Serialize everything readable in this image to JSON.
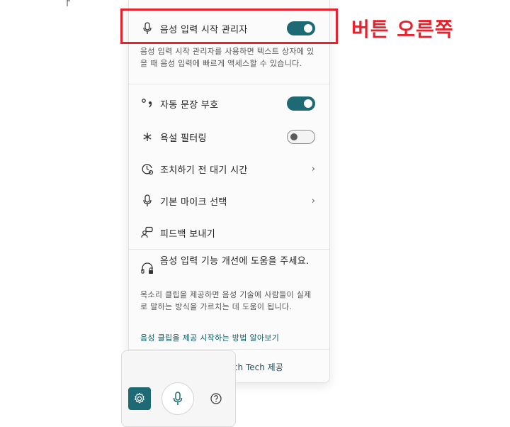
{
  "settings": {
    "launcher": {
      "label": "음성 입력 시작 관리자",
      "enabled": true,
      "description": "음성 입력 시작 관리자를 사용하면 텍스트 상자에 있을 때 음성 입력에 빠르게 액세스할 수 있습니다."
    },
    "auto_punctuation": {
      "label": "자동 문장 부호",
      "enabled": true
    },
    "profanity_filter": {
      "label": "욕설 필터링",
      "enabled": false
    },
    "wait_time": {
      "label": "조치하기 전 대기 시간"
    },
    "default_mic": {
      "label": "기본 마이크 선택"
    },
    "feedback": {
      "label": "피드백 보내기"
    },
    "improve": {
      "title": "음성 입력 기능 개선에 도움을 주세요.",
      "description": "목소리 클립을 제공하면 음성 기술에 사람들이 실제로 말하는 방식을 가르치는 데 도움이 됩니다.",
      "link": "음성 클립을 제공 시작하는 방법 알아보기"
    },
    "provider": "Microsoft Online Speech Tech 제공"
  },
  "annotation": {
    "text": "버튼 오른쪽",
    "color": "#e8222d"
  },
  "colors": {
    "accent": "#1d6a75",
    "link": "#0f5b66"
  },
  "icons": {
    "launcher": "mic-icon",
    "auto_punctuation": "punctuation-icon",
    "profanity_filter": "asterisk-icon",
    "wait_time": "timer-icon",
    "default_mic": "mic-icon",
    "feedback": "feedback-icon",
    "improve": "lock-headset-icon",
    "toolbar_settings": "gear-icon",
    "toolbar_mic": "mic-icon",
    "toolbar_help": "help-icon"
  }
}
